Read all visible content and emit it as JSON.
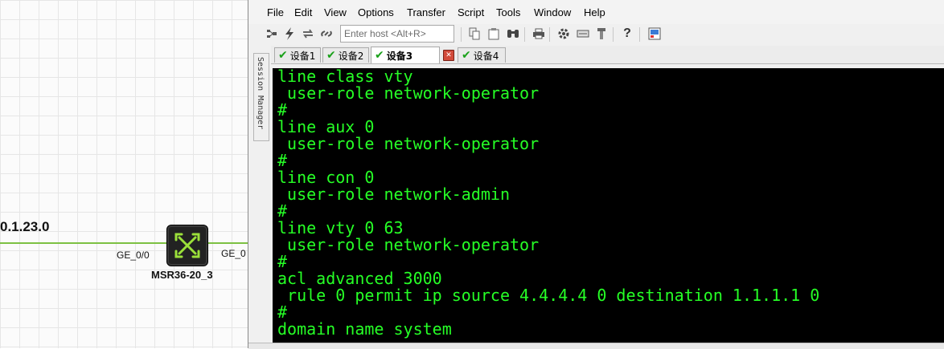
{
  "topology": {
    "network_label": "0.1.23.0",
    "left_port": "GE_0/0",
    "right_port": "GE_0",
    "device_name": "MSR36-20_3",
    "line_color": "#7dc142"
  },
  "menu": [
    "File",
    "Edit",
    "View",
    "Options",
    "Transfer",
    "Script",
    "Tools",
    "Window",
    "Help"
  ],
  "toolbar": {
    "host_placeholder": "Enter host <Alt+R>",
    "icons": [
      "connect-in-tab-icon",
      "quick-connect-icon",
      "reconnect-icon",
      "disconnect-icon",
      "copy-icon",
      "paste-icon",
      "find-icon",
      "print-icon",
      "settings-icon",
      "keymap-icon",
      "sftp-icon",
      "help-icon",
      "screen-icon"
    ]
  },
  "tabs": [
    {
      "label": "设备1",
      "active": false
    },
    {
      "label": "设备2",
      "active": false
    },
    {
      "label": "设备3",
      "active": true
    },
    {
      "label": "设备4",
      "active": false
    }
  ],
  "session_manager_label": "Session Manager",
  "terminal": {
    "color": "#26ff26",
    "lines": [
      "line class vty",
      " user-role network-operator",
      "#",
      "line aux 0",
      " user-role network-operator",
      "#",
      "line con 0",
      " user-role network-admin",
      "#",
      "line vty 0 63",
      " user-role network-operator",
      "#",
      "acl advanced 3000",
      " rule 0 permit ip source 4.4.4.4 0 destination 1.1.1.1 0",
      "#",
      "domain name system"
    ]
  }
}
